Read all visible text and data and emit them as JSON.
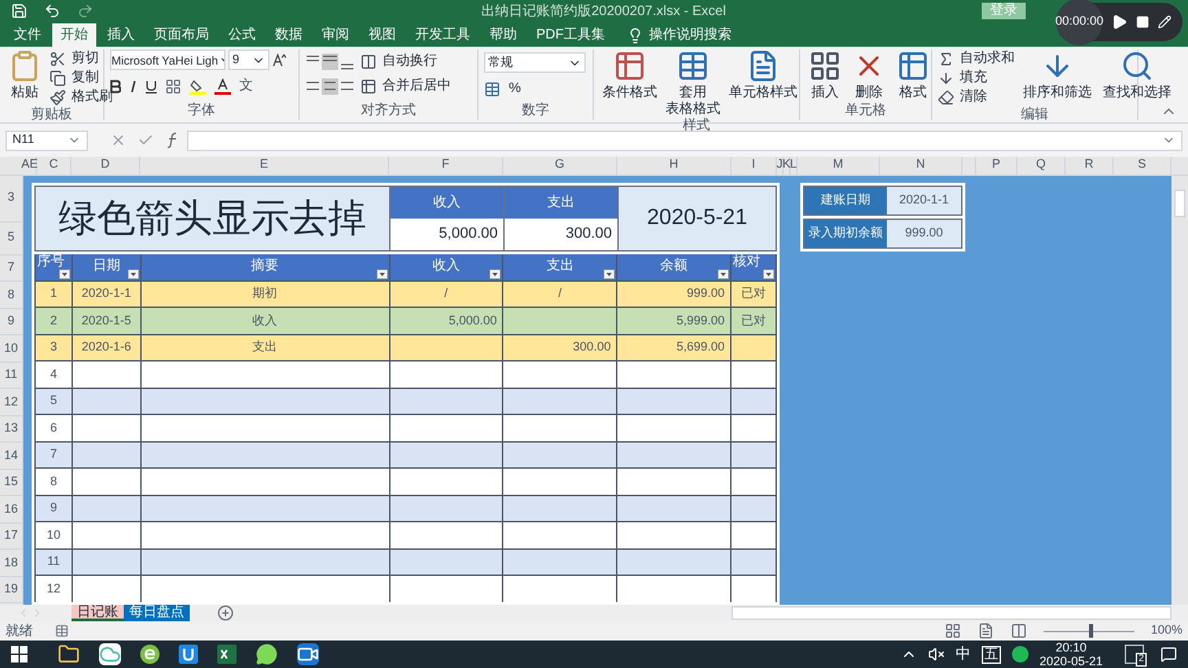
{
  "title_bar": {
    "title": "出纳日记账简约版20200207.xlsx - Excel",
    "login": "登录"
  },
  "recorder": {
    "time": "00:00:00"
  },
  "ribbon_tabs": [
    {
      "label": "文件",
      "selected": false
    },
    {
      "label": "开始",
      "selected": true
    },
    {
      "label": "插入",
      "selected": false
    },
    {
      "label": "页面布局",
      "selected": false
    },
    {
      "label": "公式",
      "selected": false
    },
    {
      "label": "数据",
      "selected": false
    },
    {
      "label": "审阅",
      "selected": false
    },
    {
      "label": "视图",
      "selected": false
    },
    {
      "label": "开发工具",
      "selected": false
    },
    {
      "label": "帮助",
      "selected": false
    },
    {
      "label": "PDF工具集",
      "selected": false
    }
  ],
  "tell_me": "操作说明搜索",
  "ribbon": {
    "clipboard": {
      "paste": "粘贴",
      "cut": "剪切",
      "copy": "复制",
      "format_painter": "格式刷",
      "label": "剪贴板"
    },
    "font": {
      "name": "Microsoft YaHei Ligh",
      "size": "9",
      "phonetic": "文",
      "label": "字体"
    },
    "alignment": {
      "wrap": "自动换行",
      "merge": "合并后居中",
      "label": "对齐方式"
    },
    "number": {
      "format": "常规",
      "percent": "%",
      "label": "数字"
    },
    "styles": {
      "conditional": "条件格式",
      "table_line1": "套用",
      "table_line2": "表格格式",
      "cell_styles": "单元格样式",
      "label": "样式"
    },
    "cells": {
      "insert": "插入",
      "delete": "删除",
      "format": "格式",
      "label": "单元格"
    },
    "editing": {
      "autosum": "自动求和",
      "fill": "填充",
      "clear": "清除",
      "sort": "排序和筛选",
      "find": "查找和选择",
      "label": "编辑"
    }
  },
  "formula_bar": {
    "name_box": "N11"
  },
  "columns": [
    "AE",
    "C",
    "D",
    "E",
    "F",
    "G",
    "H",
    "I",
    "J",
    "K",
    "L",
    "M",
    "N",
    "",
    "P",
    "Q",
    "R",
    "S"
  ],
  "row_numbers": [
    "3",
    "5",
    "7",
    "8",
    "9",
    "10",
    "11",
    "12",
    "13",
    "14",
    "15",
    "16",
    "17",
    "18",
    "19"
  ],
  "sheet": {
    "title": "绿色箭头显示去掉",
    "income_label": "收入",
    "income_total": "5,000.00",
    "expense_label": "支出",
    "expense_total": "300.00",
    "date": "2020-5-21",
    "headers": [
      "序号",
      "日期",
      "摘要",
      "收入",
      "支出",
      "余额",
      "核对"
    ],
    "rows": [
      {
        "no": "1",
        "date": "2020-1-1",
        "summary": "期初",
        "income": "/",
        "expense": "/",
        "balance": "999.00",
        "check": "已对",
        "color": "#ffe699"
      },
      {
        "no": "2",
        "date": "2020-1-5",
        "summary": "收入",
        "income": "5,000.00",
        "balance": "5,999.00",
        "check": "已对",
        "color": "#c6e0b4"
      },
      {
        "no": "3",
        "date": "2020-1-6",
        "summary": "支出",
        "expense": "300.00",
        "balance": "5,699.00",
        "color": "#ffe699"
      },
      {
        "no": "4"
      },
      {
        "no": "5"
      },
      {
        "no": "6"
      },
      {
        "no": "7"
      },
      {
        "no": "8"
      },
      {
        "no": "9"
      },
      {
        "no": "10"
      },
      {
        "no": "11"
      },
      {
        "no": "12"
      }
    ]
  },
  "side_box": [
    {
      "label": "建账日期",
      "value": "2020-1-1"
    },
    {
      "label": "录入期初余额",
      "value": "999.00"
    }
  ],
  "sheet_tabs": [
    {
      "label": "日记账",
      "selected": true,
      "color": "#f4c7c3"
    },
    {
      "label": "每日盘点",
      "selected": false,
      "color": "#0070c0"
    }
  ],
  "status_bar": {
    "status": "就绪",
    "zoom": "100%",
    "level": 0.5
  },
  "taskbar": {
    "ime": "中",
    "ime_mode": "五",
    "notifications": "2",
    "time": "20:10",
    "date": "2020-05-21"
  }
}
